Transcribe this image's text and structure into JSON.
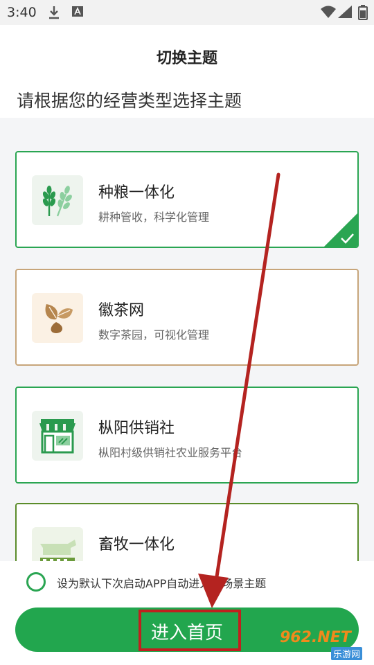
{
  "status_bar": {
    "time": "3:40"
  },
  "header": {
    "title": "切换主题",
    "subtitle": "请根据您的经营类型选择主题"
  },
  "themes": [
    {
      "title": "种粮一体化",
      "desc": "耕种管收，科学化管理",
      "selected": true,
      "border_color": "#2aa552",
      "icon": "wheat-icon"
    },
    {
      "title": "徽茶网",
      "desc": "数字茶园，可视化管理",
      "selected": false,
      "border_color": "#c7a57a",
      "icon": "tea-leaves-icon"
    },
    {
      "title": "枞阳供销社",
      "desc": "枞阳村级供销社农业服务平台",
      "selected": false,
      "border_color": "#2aa552",
      "icon": "store-icon"
    },
    {
      "title": "畜牧一体化",
      "desc": "",
      "selected": false,
      "border_color": "#5b8c2a",
      "icon": "livestock-icon"
    }
  ],
  "default_option": {
    "label": "设为默认下次启动APP自动进入此场景主题",
    "checked": false
  },
  "enter_button": {
    "label": "进入首页"
  },
  "watermark": {
    "main": "962.NET",
    "sub": "乐游网"
  },
  "colors": {
    "accent": "#22a64e",
    "highlight": "#c0201e"
  }
}
